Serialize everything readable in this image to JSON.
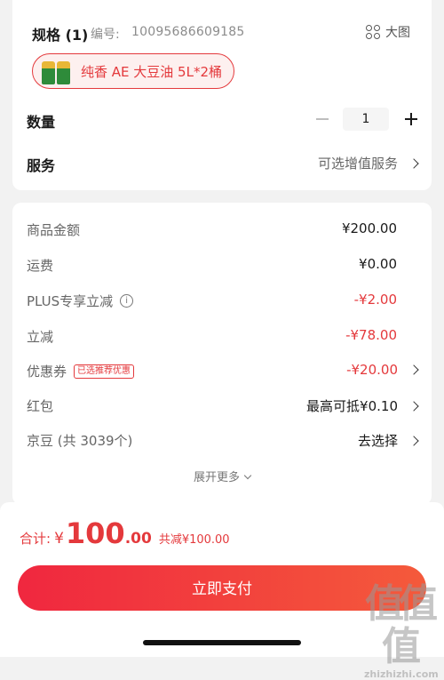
{
  "spec": {
    "title": "规格 (1)",
    "number_label": "编号:",
    "number": "10095686609185",
    "big_image_label": "大图",
    "selected_option": "纯香 AE 大豆油 5L*2桶"
  },
  "quantity": {
    "label": "数量",
    "value": "1"
  },
  "service": {
    "label": "服务",
    "value": "可选增值服务"
  },
  "price_lines": [
    {
      "label": "商品金额",
      "value": "¥200.00"
    },
    {
      "label": "运费",
      "value": "¥0.00"
    },
    {
      "label": "PLUS专享立减",
      "info_icon": "i",
      "value": "-¥2.00"
    },
    {
      "label": "立减",
      "value": "-¥78.00"
    },
    {
      "label": "优惠券",
      "tag": "已选推荐优惠",
      "value": "-¥20.00"
    },
    {
      "label": "红包",
      "value": "最高可抵¥0.10"
    },
    {
      "label": "京豆 (共 3039个)",
      "value": "去选择"
    }
  ],
  "expand_label": "展开更多",
  "total": {
    "label": "合计:",
    "currency": "¥",
    "amount_int": "100",
    "amount_dec": ".00",
    "saved": "共减¥100.00"
  },
  "pay_button": "立即支付",
  "watermark": {
    "mark": "值值值",
    "text": "zhizhizhi.com"
  },
  "colors": {
    "accent": "#e4393c",
    "button_start": "#f0273f",
    "button_end": "#f45a3b"
  }
}
